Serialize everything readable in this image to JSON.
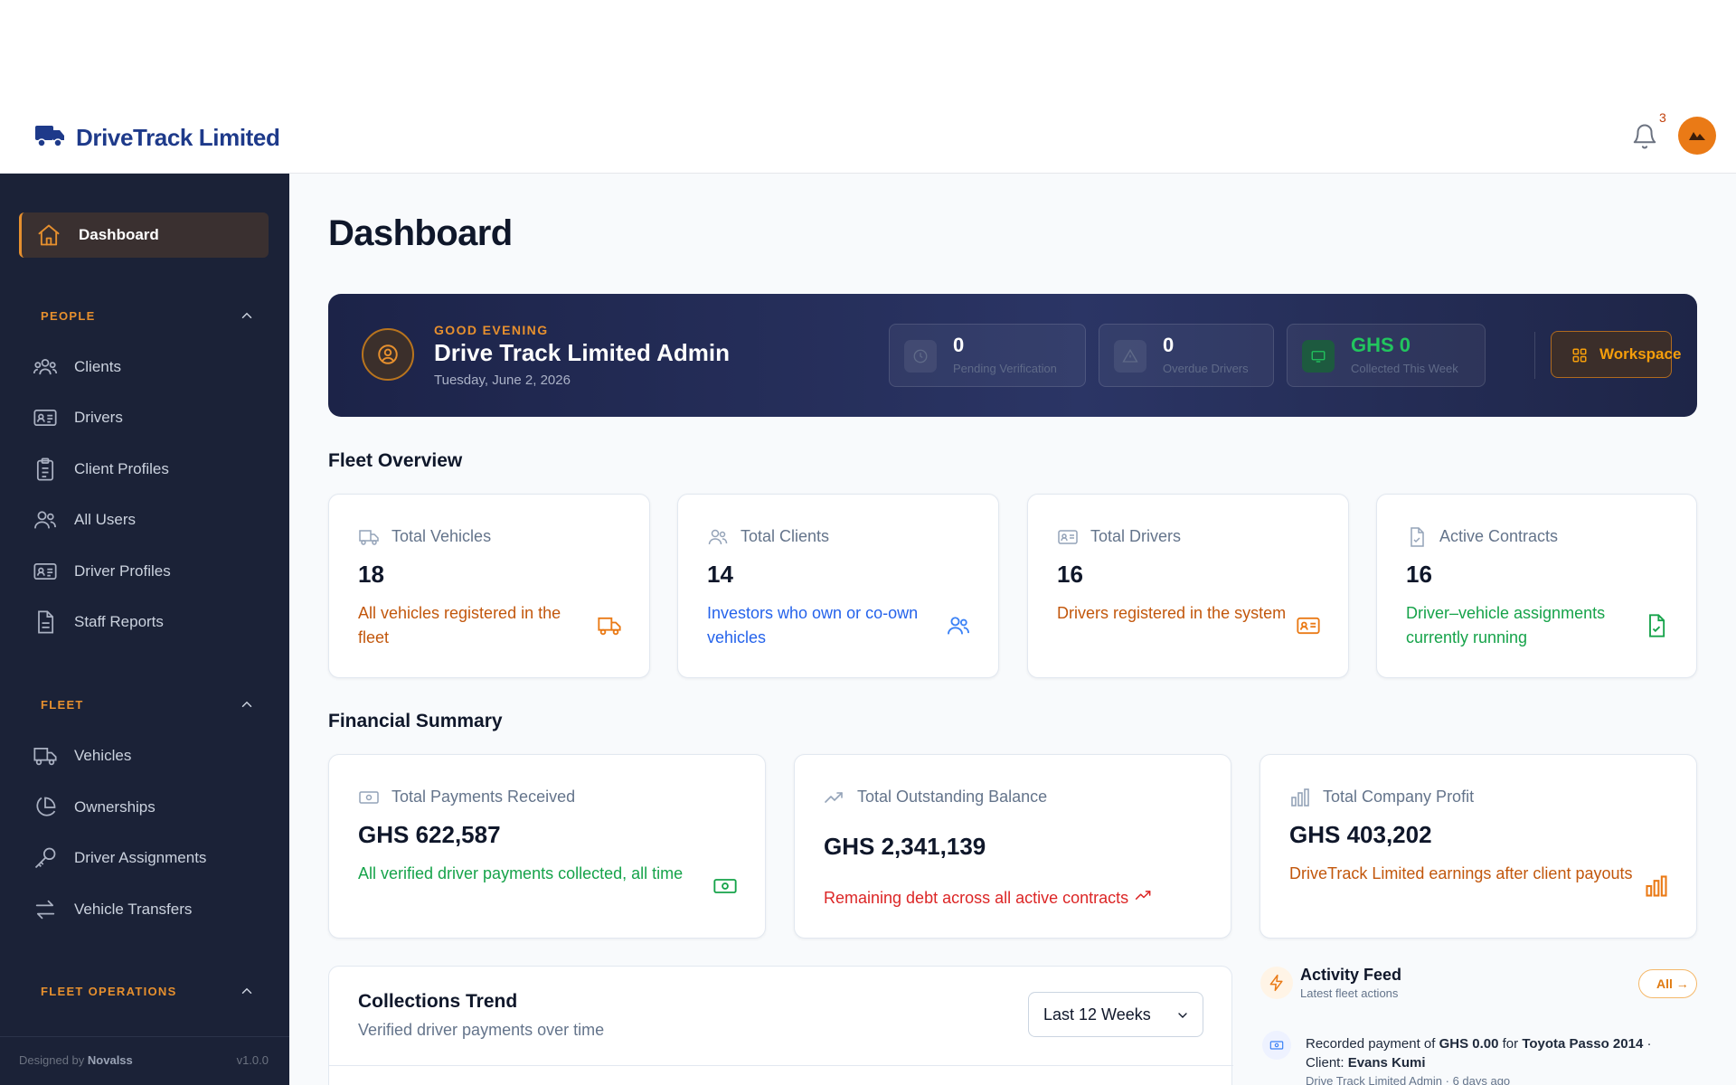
{
  "app": {
    "brand": "DriveTrack Limited",
    "notification_count": "3"
  },
  "sidebar": {
    "active": {
      "label": "Dashboard"
    },
    "sections": [
      {
        "title": "PEOPLE",
        "items": [
          {
            "label": "Clients"
          },
          {
            "label": "Drivers"
          },
          {
            "label": "Client Profiles"
          },
          {
            "label": "All Users"
          },
          {
            "label": "Driver Profiles"
          },
          {
            "label": "Staff Reports"
          }
        ]
      },
      {
        "title": "FLEET",
        "items": [
          {
            "label": "Vehicles"
          },
          {
            "label": "Ownerships"
          },
          {
            "label": "Driver Assignments"
          },
          {
            "label": "Vehicle Transfers"
          }
        ]
      },
      {
        "title": "FLEET OPERATIONS",
        "items": []
      }
    ],
    "footer": {
      "designed_by": "Designed by",
      "designer": "Novalss",
      "version": "v1.0.0"
    }
  },
  "page": {
    "title": "Dashboard"
  },
  "hero": {
    "greeting": "GOOD EVENING",
    "name": "Drive Track Limited Admin",
    "date": "Tuesday, June 2, 2026",
    "stats": [
      {
        "value": "0",
        "label": "Pending Verification"
      },
      {
        "value": "0",
        "label": "Overdue Drivers"
      },
      {
        "value": "GHS 0",
        "label": "Collected This Week"
      }
    ],
    "workspace_label": "Workspace"
  },
  "fleet_overview": {
    "title": "Fleet Overview",
    "cards": [
      {
        "label": "Total Vehicles",
        "value": "18",
        "desc": "All vehicles registered in the fleet",
        "color": "#c2570c"
      },
      {
        "label": "Total Clients",
        "value": "14",
        "desc": "Investors who own or co-own vehicles",
        "color": "#2563eb"
      },
      {
        "label": "Total Drivers",
        "value": "16",
        "desc": "Drivers registered in the system",
        "color": "#c2570c"
      },
      {
        "label": "Active Contracts",
        "value": "16",
        "desc": "Driver–vehicle assignments currently running",
        "color": "#16a34a"
      }
    ]
  },
  "financial_summary": {
    "title": "Financial Summary",
    "cards": [
      {
        "label": "Total Payments Received",
        "value": "GHS 622,587",
        "desc": "All verified driver payments collected, all time",
        "color": "#16a34a"
      },
      {
        "label": "Total Outstanding Balance",
        "value": "GHS 2,341,139",
        "desc": "Remaining debt across all active contracts",
        "color": "#dc2626"
      },
      {
        "label": "Total Company Profit",
        "value": "GHS 403,202",
        "desc": "DriveTrack Limited earnings after client payouts",
        "color": "#c2570c"
      }
    ]
  },
  "collections_trend": {
    "title": "Collections Trend",
    "subtitle": "Verified driver payments over time",
    "range_selected": "Last 12 Weeks"
  },
  "activity_feed": {
    "title": "Activity Feed",
    "subtitle": "Latest fleet actions",
    "all_label": "All →",
    "entries": [
      {
        "prefix": "Recorded payment of",
        "amount": "GHS 0.00",
        "mid": "for",
        "vehicle": "Toyota Passo 2014",
        "sep": "·",
        "client_label": "Client:",
        "client": "Evans Kumi",
        "actor": "Drive Track Limited Admin",
        "time": "6 days ago"
      }
    ]
  }
}
